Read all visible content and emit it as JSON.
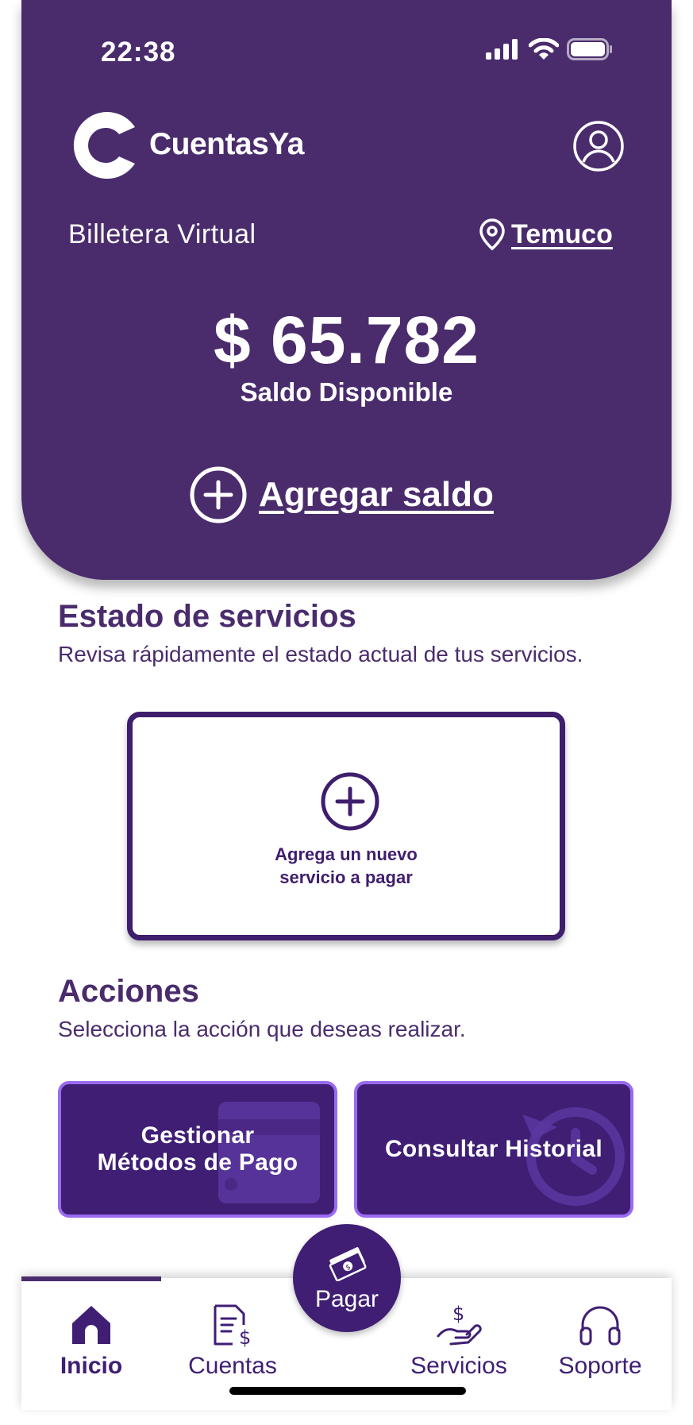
{
  "status_bar": {
    "time": "22:38"
  },
  "header": {
    "brand": "CuentasYa",
    "wallet_label": "Billetera Virtual",
    "location": "Temuco",
    "balance": "$ 65.782",
    "balance_label": "Saldo Disponible",
    "add_balance_label": "Agregar saldo"
  },
  "services_section": {
    "title": "Estado de servicios",
    "subtitle": "Revisa rápidamente el estado actual de tus servicios.",
    "add_card_line1": "Agrega un nuevo",
    "add_card_line2": "servicio a pagar"
  },
  "actions_section": {
    "title": "Acciones",
    "subtitle": "Selecciona la acción que deseas realizar.",
    "buttons": [
      {
        "line1": "Gestionar",
        "line2": "Métodos de Pago"
      },
      {
        "label": "Consultar Historial"
      }
    ]
  },
  "bottom_nav": {
    "items": [
      {
        "label": "Inicio",
        "icon": "home-icon",
        "active": true
      },
      {
        "label": "Cuentas",
        "icon": "bill-icon"
      },
      {
        "label": "Servicios",
        "icon": "hand-money-icon"
      },
      {
        "label": "Soporte",
        "icon": "headphones-icon"
      }
    ],
    "fab_label": "Pagar"
  },
  "colors": {
    "primary": "#4a2c6d",
    "button_bg": "#3f1e74",
    "button_border": "#9b6af2",
    "white": "#ffffff"
  }
}
